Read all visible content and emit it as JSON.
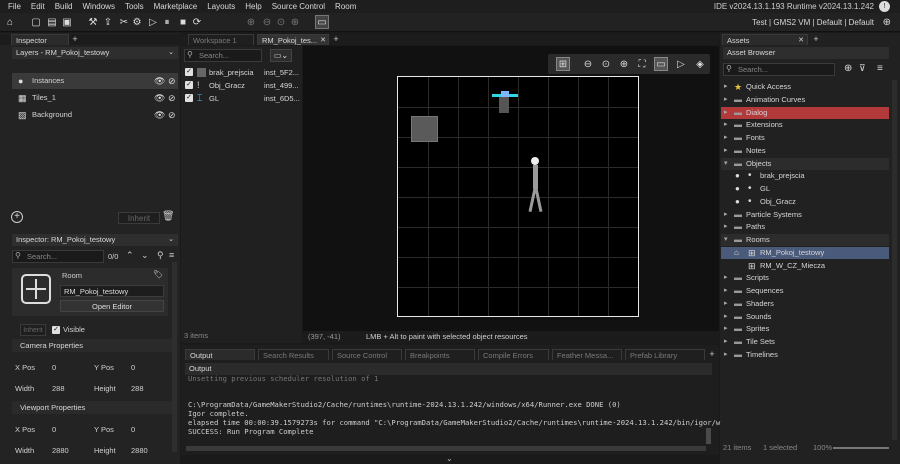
{
  "menubar": {
    "items": [
      "File",
      "Edit",
      "Build",
      "Windows",
      "Tools",
      "Marketplace",
      "Layouts",
      "Help",
      "Source Control",
      "Room"
    ],
    "version": "IDE v2024.13.1.193  Runtime v2024.13.1.242"
  },
  "toolbar": {
    "right_info": "Test | GMS2 VM | Default | Default"
  },
  "left": {
    "inspector_tab": "Inspector",
    "layers_title": "Layers - RM_Pokoj_testowy",
    "layers": [
      "Instances",
      "Tiles_1",
      "Background"
    ],
    "inherit_label": "Inherit",
    "inspector_title": "Inspector: RM_Pokoj_testowy",
    "search_placeholder": "Search...",
    "page_count": "0/0",
    "room_label": "Room",
    "room_name": "RM_Pokoj_testowy",
    "open_editor": "Open Editor",
    "inherit2": "Inherit",
    "visible": "Visible",
    "camera_props": "Camera Properties",
    "viewport_props": "Viewport Properties",
    "xpos": "X Pos",
    "ypos": "Y Pos",
    "width": "Width",
    "height": "Height",
    "cam_x": "0",
    "cam_y": "0",
    "cam_w": "288",
    "cam_h": "288",
    "vp_x": "0",
    "vp_y": "0",
    "vp_w": "2880",
    "vp_h": "2880"
  },
  "center": {
    "tabs": [
      "Workspace 1",
      "RM_Pokoj_tes..."
    ],
    "search_placeholder": "Search...",
    "instances": [
      {
        "name": "brak_prejscia",
        "id": "inst_5F2..."
      },
      {
        "name": "Obj_Gracz",
        "id": "inst_499..."
      },
      {
        "name": "GL",
        "id": "inst_6D5..."
      }
    ],
    "items_count": "3 items",
    "coords": "(397, -41)",
    "hint": "LMB + Alt to paint with selected object resources"
  },
  "output": {
    "tabs": [
      "Output",
      "Search Results",
      "Source Control",
      "Breakpoints",
      "Compile Errors",
      "Feather Messa...",
      "Prefab Library"
    ],
    "title": "Output",
    "lines": [
      "Unsetting previous scheduler resolution of 1",
      "",
      "C:\\ProgramData/GameMakerStudio2/Cache/runtimes\\runtime-2024.13.1.242/windows/x64/Runner.exe DONE (0)",
      "Igor complete.",
      "elapsed time 00:00:39.1579273s for command \"C:\\ProgramData/GameMakerStudio2/Cache/runtimes\\runtime-2024.13.1.242/bin/igor/w",
      "SUCCESS: Run Program Complete"
    ]
  },
  "assets": {
    "tab": "Assets",
    "browser_title": "Asset Browser",
    "search_placeholder": "Search...",
    "tree": [
      {
        "label": "Quick Access",
        "level": 0,
        "kind": "star"
      },
      {
        "label": "Animation Curves",
        "level": 0,
        "kind": "folder"
      },
      {
        "label": "Dialog",
        "level": 0,
        "kind": "folder",
        "highlight": "red"
      },
      {
        "label": "Extensions",
        "level": 0,
        "kind": "folder"
      },
      {
        "label": "Fonts",
        "level": 0,
        "kind": "folder"
      },
      {
        "label": "Notes",
        "level": 0,
        "kind": "folder"
      },
      {
        "label": "Objects",
        "level": 0,
        "kind": "folder-open"
      },
      {
        "label": "brak_prejscia",
        "level": 1,
        "kind": "obj"
      },
      {
        "label": "GL",
        "level": 1,
        "kind": "obj"
      },
      {
        "label": "Obj_Gracz",
        "level": 1,
        "kind": "obj"
      },
      {
        "label": "Particle Systems",
        "level": 0,
        "kind": "folder"
      },
      {
        "label": "Paths",
        "level": 0,
        "kind": "folder"
      },
      {
        "label": "Rooms",
        "level": 0,
        "kind": "folder-open"
      },
      {
        "label": "RM_Pokoj_testowy",
        "level": 1,
        "kind": "room",
        "selected": true
      },
      {
        "label": "RM_W_CZ_Miecza",
        "level": 1,
        "kind": "room"
      },
      {
        "label": "Scripts",
        "level": 0,
        "kind": "folder"
      },
      {
        "label": "Sequences",
        "level": 0,
        "kind": "folder"
      },
      {
        "label": "Shaders",
        "level": 0,
        "kind": "folder"
      },
      {
        "label": "Sounds",
        "level": 0,
        "kind": "folder"
      },
      {
        "label": "Sprites",
        "level": 0,
        "kind": "folder"
      },
      {
        "label": "Tile Sets",
        "level": 0,
        "kind": "folder"
      },
      {
        "label": "Timelines",
        "level": 0,
        "kind": "folder"
      }
    ],
    "footer_count": "21 items",
    "footer_selected": "1 selected",
    "zoom": "100%"
  },
  "colors": {
    "accent_cyan": "#2fd6e6",
    "highlight_red": "#b23a3a",
    "selected_blue": "#4a5a7a"
  }
}
